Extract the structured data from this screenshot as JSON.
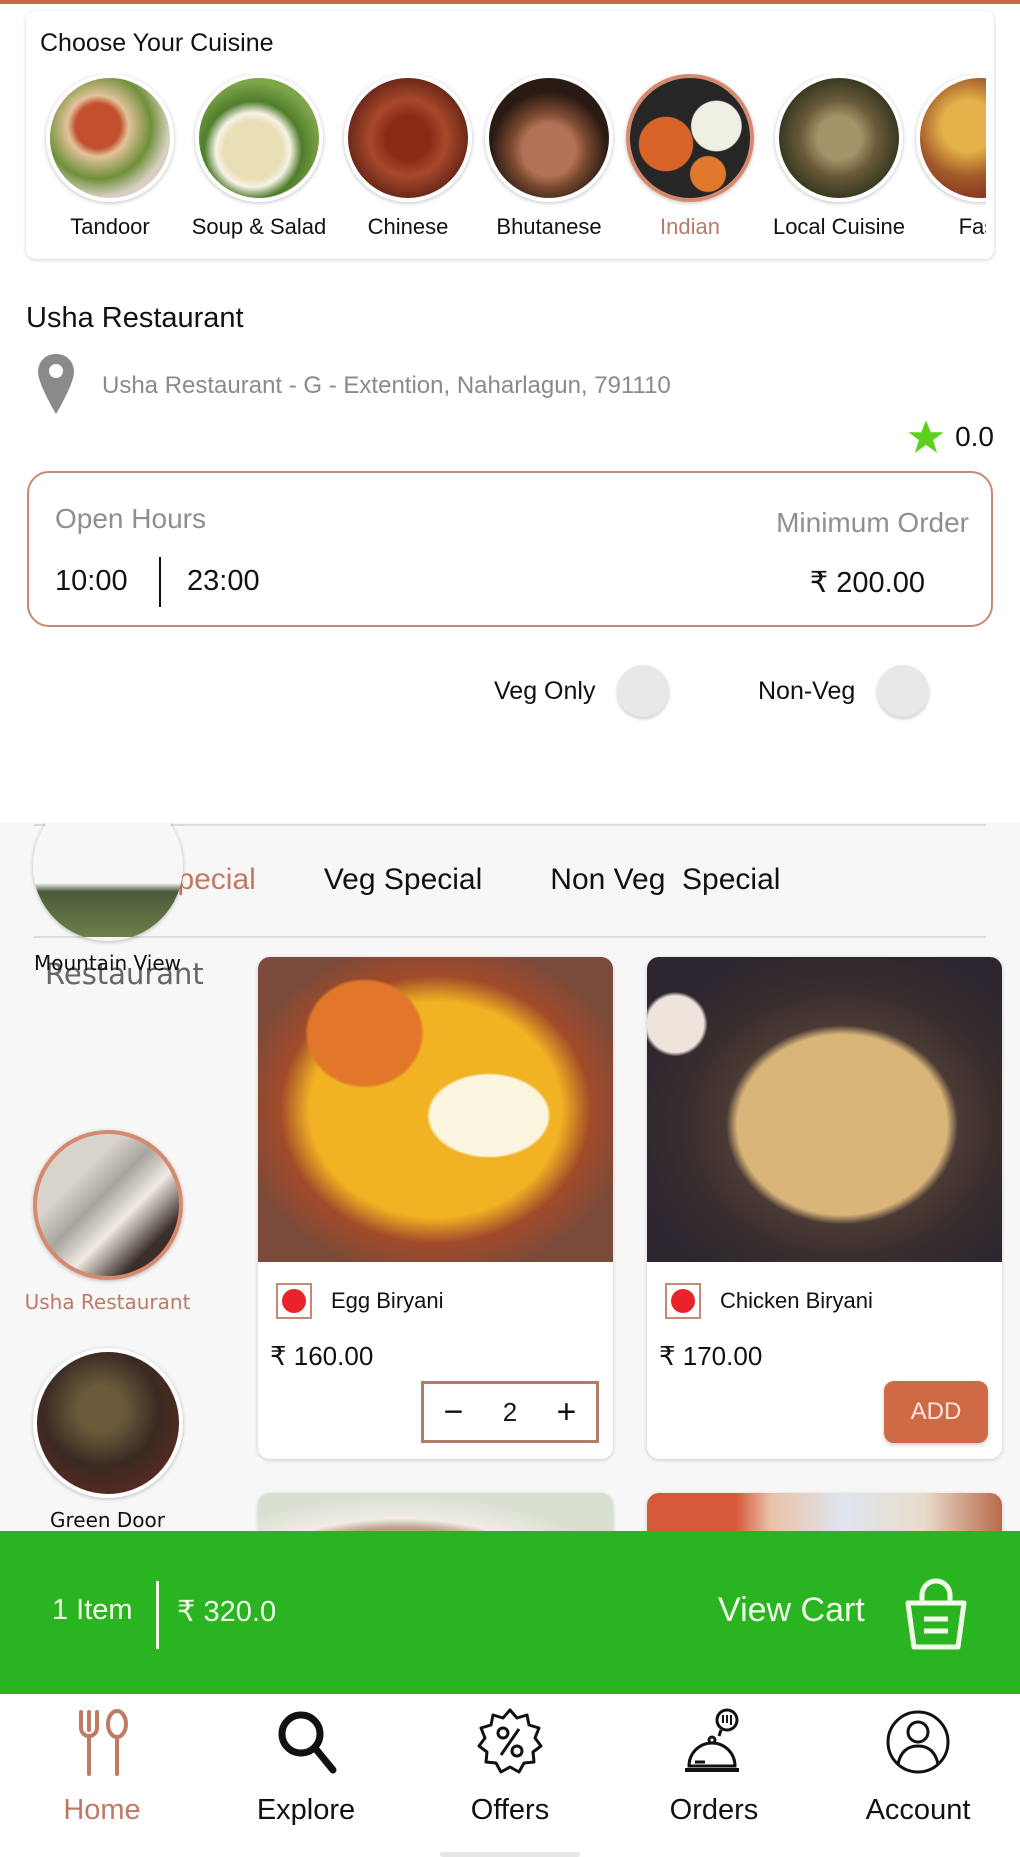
{
  "theme": {
    "accent": "#c9694a",
    "cart_green": "#2ab421",
    "rating_star": "#5fcf1e",
    "nonveg_marker": "#e8232a"
  },
  "cuisines": {
    "title": "Choose Your Cuisine",
    "items": [
      {
        "label": "Tandoor",
        "active": false
      },
      {
        "label": "Soup & Salad",
        "active": false
      },
      {
        "label": "Chinese",
        "active": false
      },
      {
        "label": "Bhutanese",
        "active": false
      },
      {
        "label": "Indian",
        "active": true
      },
      {
        "label": "Local Cuisine",
        "active": false
      },
      {
        "label": "Fast",
        "active": false
      }
    ]
  },
  "restaurant": {
    "name": "Usha Restaurant",
    "address": "Usha Restaurant - G - Extention, Naharlagun, 791110",
    "rating": "0.0",
    "icons": {
      "location": "map-pin-icon",
      "rating": "star-icon"
    }
  },
  "hours": {
    "open_label": "Open Hours",
    "from": "10:00",
    "to": "23:00",
    "min_order_label": "Minimum Order",
    "min_order_value": "₹ 200.00"
  },
  "filters": {
    "veg_only_label": "Veg Only",
    "veg_only_on": false,
    "non_veg_label": "Non-Veg",
    "non_veg_on": false
  },
  "menu_tabs": [
    {
      "label": "Non Veg Special",
      "active": true
    },
    {
      "label": "Veg Special",
      "active": false
    },
    {
      "label": "Non Veg  Special",
      "active": false
    }
  ],
  "restaurant_list": {
    "title": "Restaurant",
    "items": [
      {
        "label": "Mountain View",
        "active": false
      },
      {
        "label": "Usha Restaurant",
        "active": true
      },
      {
        "label": "Green Door",
        "active": false
      }
    ]
  },
  "foods": [
    {
      "name": "Egg Biryani",
      "price": "₹ 160.00",
      "type": "non-veg",
      "quantity": "2",
      "in_cart": true
    },
    {
      "name": "Chicken Biryani",
      "price": "₹ 170.00",
      "type": "non-veg",
      "add_label": "ADD",
      "in_cart": false
    }
  ],
  "cart": {
    "count_label": "1 Item",
    "total": "₹ 320.0",
    "view_label": "View Cart",
    "icon": "basket-icon"
  },
  "nav": [
    {
      "label": "Home",
      "icon": "fork-spoon-icon",
      "active": true
    },
    {
      "label": "Explore",
      "icon": "search-icon",
      "active": false
    },
    {
      "label": "Offers",
      "icon": "discount-badge-icon",
      "active": false
    },
    {
      "label": "Orders",
      "icon": "cloche-icon",
      "active": false
    },
    {
      "label": "Account",
      "icon": "user-circle-icon",
      "active": false
    }
  ]
}
